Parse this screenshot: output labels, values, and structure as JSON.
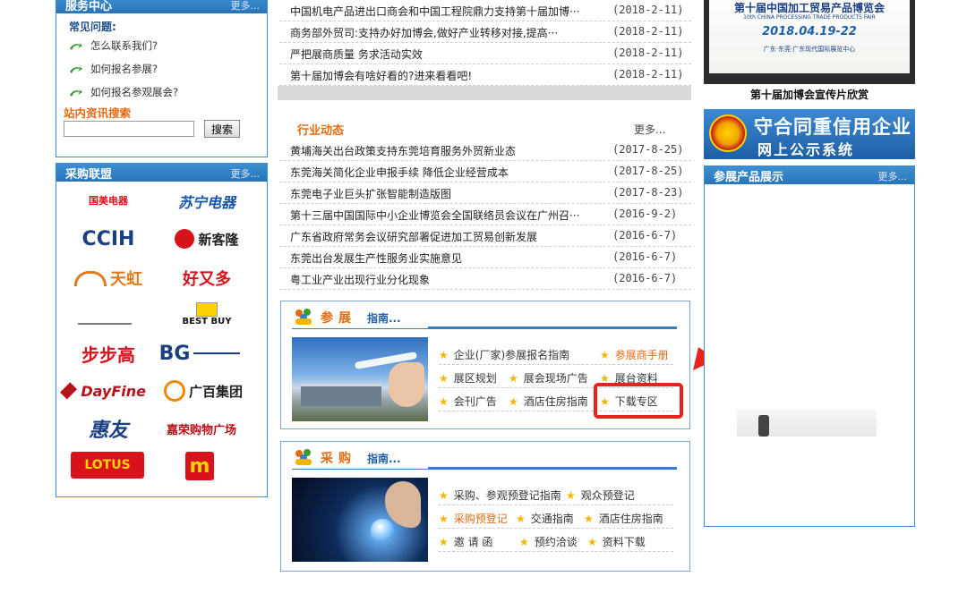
{
  "service": {
    "title": "服务中心",
    "more": "更多..."
  },
  "faq": {
    "title": "常见问题:",
    "items": [
      "怎么联系我们?",
      "如何报名参展?",
      "如何报名参观展会?"
    ]
  },
  "site_search": {
    "title": "站内资讯搜索",
    "button": "搜索",
    "value": ""
  },
  "purchase_union": {
    "title": "采购联盟",
    "more": "更多...",
    "brands": [
      "国美电器",
      "苏宁电器",
      "CCIH",
      "新客隆",
      "天虹",
      "好又多",
      "BEST BUY",
      "步步高",
      "BG",
      "DayFine",
      "广百集团",
      "惠友",
      "嘉荣购物广场",
      "LOTUS"
    ]
  },
  "top_news": [
    {
      "text": "中国机电产品进出口商会和中国工程院鼎力支持第十届加博···",
      "date": "(2018-2-11)"
    },
    {
      "text": "商务部外贸司:支持办好加博会,做好产业转移对接,提高···",
      "date": "(2018-2-11)"
    },
    {
      "text": "严把展商质量 务求活动实效",
      "date": "(2018-2-11)"
    },
    {
      "text": "第十届加博会有啥好看的?进来看看吧!",
      "date": "(2018-2-11)"
    }
  ],
  "industry": {
    "title": "行业动态",
    "more": "更多...",
    "items": [
      {
        "text": "黄埔海关出台政策支持东莞培育服务外贸新业态",
        "date": "(2017-8-25)"
      },
      {
        "text": "东莞海关简化企业申报手续 降低企业经营成本",
        "date": "(2017-8-25)"
      },
      {
        "text": "东莞电子业巨头扩张智能制造版图",
        "date": "(2017-8-23)"
      },
      {
        "text": "第十三届中国国际中小企业博览会全国联络员会议在广州召···",
        "date": "(2016-9-2)"
      },
      {
        "text": "广东省政府常务会议研究部署促进加工贸易创新发展",
        "date": "(2016-6-7)"
      },
      {
        "text": "东莞出台发展生产性服务业实施意见",
        "date": "(2016-6-7)"
      },
      {
        "text": "粤工业产业出现行业分化现象",
        "date": "(2016-6-7)"
      }
    ]
  },
  "exhibit_guide": {
    "title": "参展",
    "subtitle": "指南...",
    "items": [
      "企业(厂家)参展报名指南",
      "参展商手册",
      "展区规划",
      "展会现场广告",
      "展台资料",
      "会刊广告",
      "酒店住房指南",
      "下载专区"
    ]
  },
  "purchase_guide": {
    "title": "采购",
    "subtitle": "指南...",
    "items": [
      "采购、参观预登记指南",
      "观众预登记",
      "采购预登记",
      "交通指南",
      "酒店住房指南",
      "邀 请 函",
      "预约洽谈",
      "资料下载"
    ]
  },
  "promo": {
    "banner_title": "第十届中国加工贸易产品博览会",
    "banner_en": "10th CHINA PROCESSING TRADE PRODUCTS FAIR",
    "banner_date": "2018.04.19-22",
    "banner_venue": "广东·东莞·广东现代国际展览中心",
    "caption": "第十届加博会宣传片欣赏"
  },
  "credit": {
    "line1": "守合同重信用企业",
    "line2": "网上公示系统"
  },
  "products": {
    "title": "参展产品展示",
    "more": "更多..."
  },
  "colors": {
    "accent_blue": "#2f7fc4",
    "orange": "#e46a12",
    "highlight_red": "#e8231e"
  }
}
